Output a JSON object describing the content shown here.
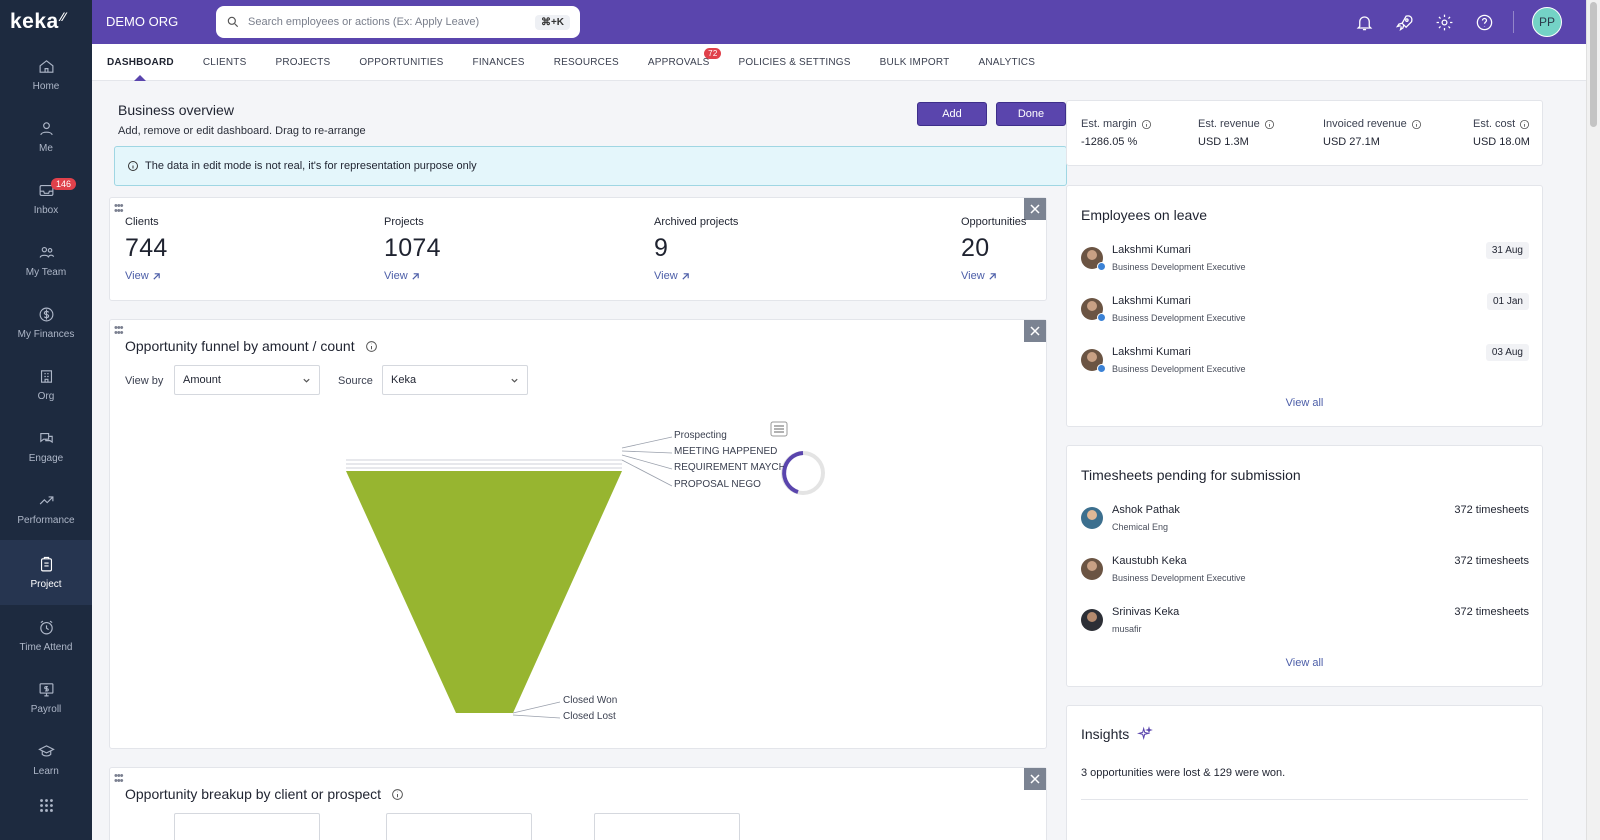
{
  "app": {
    "logo": "keka",
    "org_name": "DEMO ORG"
  },
  "search": {
    "placeholder": "Search employees or actions (Ex: Apply Leave)",
    "shortcut": "⌘+K"
  },
  "user": {
    "initials": "PP"
  },
  "sidebar": {
    "items": [
      {
        "label": "Home",
        "icon": "home-icon"
      },
      {
        "label": "Me",
        "icon": "user-icon"
      },
      {
        "label": "Inbox",
        "icon": "inbox-icon",
        "badge": "146"
      },
      {
        "label": "My Team",
        "icon": "team-icon"
      },
      {
        "label": "My Finances",
        "icon": "finances-icon"
      },
      {
        "label": "Org",
        "icon": "org-icon"
      },
      {
        "label": "Engage",
        "icon": "engage-icon"
      },
      {
        "label": "Performance",
        "icon": "performance-icon"
      },
      {
        "label": "Project",
        "icon": "project-icon",
        "active": true
      },
      {
        "label": "Time Attend",
        "icon": "clock-icon"
      },
      {
        "label": "Payroll",
        "icon": "payroll-icon"
      },
      {
        "label": "Learn",
        "icon": "learn-icon"
      }
    ]
  },
  "tabs": [
    {
      "label": "DASHBOARD",
      "active": true
    },
    {
      "label": "CLIENTS"
    },
    {
      "label": "PROJECTS"
    },
    {
      "label": "OPPORTUNITIES"
    },
    {
      "label": "FINANCES"
    },
    {
      "label": "RESOURCES"
    },
    {
      "label": "APPROVALS",
      "badge": "72"
    },
    {
      "label": "POLICIES & SETTINGS"
    },
    {
      "label": "BULK IMPORT"
    },
    {
      "label": "ANALYTICS"
    }
  ],
  "overview": {
    "title": "Business overview",
    "subtitle": "Add, remove or edit dashboard. Drag to re-arrange",
    "add_label": "Add",
    "done_label": "Done",
    "banner": "The data in edit mode is not real, it's for representation purpose only"
  },
  "stats": [
    {
      "label": "Clients",
      "value": "744",
      "link": "View"
    },
    {
      "label": "Projects",
      "value": "1074",
      "link": "View"
    },
    {
      "label": "Archived projects",
      "value": "9",
      "link": "View"
    },
    {
      "label": "Opportunities",
      "value": "20",
      "link": "View"
    }
  ],
  "funnel": {
    "title": "Opportunity funnel by amount / count",
    "view_by_label": "View by",
    "view_by_value": "Amount",
    "source_label": "Source",
    "source_value": "Keka",
    "color": "#97b530",
    "labels_top": [
      "Prospecting",
      "MEETING HAPPENED",
      "REQUIREMENT MAYCH",
      "PROPOSAL NEGO"
    ],
    "labels_bottom": [
      "Closed Won",
      "Closed Lost"
    ]
  },
  "breakup": {
    "title": "Opportunity breakup by client or prospect"
  },
  "metrics": [
    {
      "label": "Est. margin",
      "value": "-1286.05 %"
    },
    {
      "label": "Est. revenue",
      "value": "USD 1.3M"
    },
    {
      "label": "Invoiced revenue",
      "value": "USD 27.1M"
    },
    {
      "label": "Est. cost",
      "value": "USD 18.0M"
    }
  ],
  "leave": {
    "title": "Employees on leave",
    "people": [
      {
        "name": "Lakshmi Kumari",
        "role": "Business Development Executive",
        "date": "31 Aug"
      },
      {
        "name": "Lakshmi Kumari",
        "role": "Business Development Executive",
        "date": "01 Jan"
      },
      {
        "name": "Lakshmi Kumari",
        "role": "Business Development Executive",
        "date": "03 Aug"
      }
    ],
    "view_all": "View all"
  },
  "timesheets": {
    "title": "Timesheets pending for submission",
    "people": [
      {
        "name": "Ashok Pathak",
        "role": "Chemical Eng",
        "count": "372 timesheets"
      },
      {
        "name": "Kaustubh Keka",
        "role": "Business Development Executive",
        "count": "372 timesheets"
      },
      {
        "name": "Srinivas Keka",
        "role": "musafir",
        "count": "372 timesheets"
      }
    ],
    "view_all": "View all"
  },
  "insights": {
    "title": "Insights",
    "text": "3 opportunities were lost & 129 were won."
  },
  "colors": {
    "brand": "#5a45ad",
    "sidebar": "#1d2a3f",
    "link": "#4c5ea8",
    "badge": "#e0414b"
  }
}
